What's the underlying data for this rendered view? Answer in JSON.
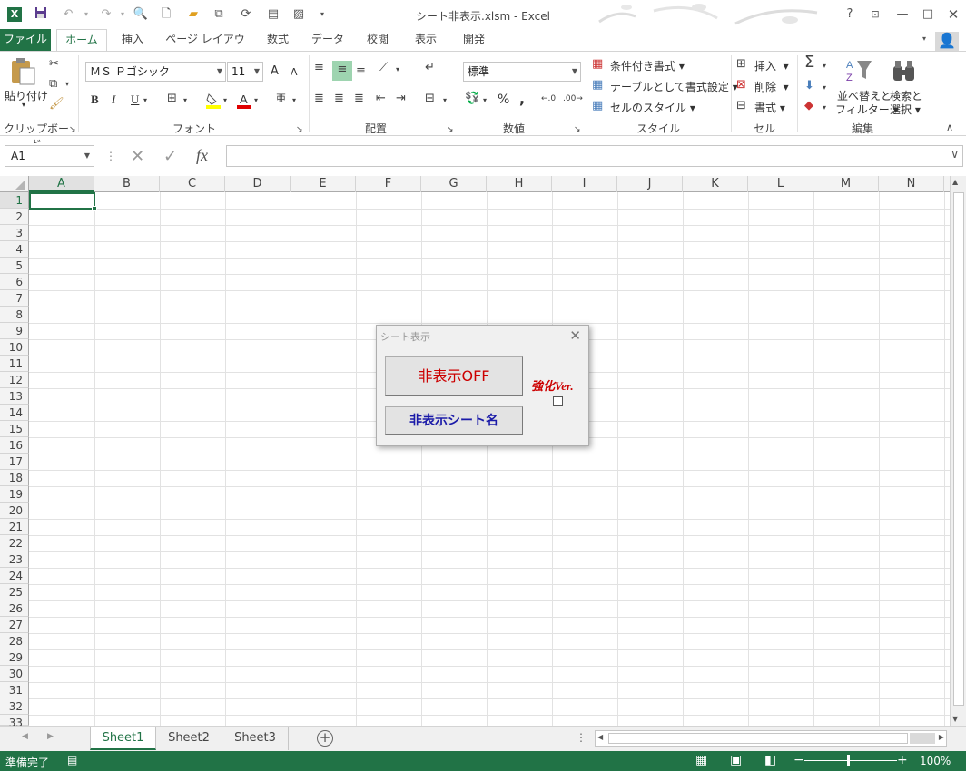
{
  "window": {
    "title": "シート非表示.xlsm - Excel"
  },
  "quick_access": {
    "save": "save-icon",
    "undo": "undo-icon",
    "redo": "redo-icon"
  },
  "tabs": [
    {
      "label": "ファイル"
    },
    {
      "label": "ホーム"
    },
    {
      "label": "挿入"
    },
    {
      "label": "ページ レイアウト"
    },
    {
      "label": "数式"
    },
    {
      "label": "データ"
    },
    {
      "label": "校閲"
    },
    {
      "label": "表示"
    },
    {
      "label": "開発"
    }
  ],
  "ribbon": {
    "clipboard": {
      "paste": "貼り付け",
      "label": "クリップボード"
    },
    "font": {
      "name": "ＭＳ Ｐゴシック",
      "size": "11",
      "bold": "B",
      "italic": "I",
      "underline": "U",
      "grow": "A",
      "shrink": "A",
      "color_a": "A",
      "label": "フォント"
    },
    "alignment": {
      "label": "配置"
    },
    "number": {
      "format": "標準",
      "percent": "%",
      "comma": ",",
      "label": "数値"
    },
    "styles": {
      "conditional": "条件付き書式",
      "table": "テーブルとして書式設定",
      "cell": "セルのスタイル",
      "label": "スタイル"
    },
    "cells": {
      "insert": "挿入",
      "delete": "削除",
      "format": "書式",
      "label": "セル"
    },
    "editing": {
      "sort": "並べ替えと",
      "sort2": "フィルター",
      "find": "検索と",
      "find2": "選択",
      "label": "編集"
    }
  },
  "formula_bar": {
    "name_box": "A1",
    "fx": "fx",
    "value": ""
  },
  "columns": [
    "A",
    "B",
    "C",
    "D",
    "E",
    "F",
    "G",
    "H",
    "I",
    "J",
    "K",
    "L",
    "M",
    "N"
  ],
  "rows": [
    "1",
    "2",
    "3",
    "4",
    "5",
    "6",
    "7",
    "8",
    "9",
    "10",
    "11",
    "12",
    "13",
    "14",
    "15",
    "16",
    "17",
    "18",
    "19",
    "20",
    "21",
    "22",
    "23",
    "24",
    "25",
    "26",
    "27",
    "28",
    "29",
    "30",
    "31",
    "32",
    "33"
  ],
  "selected_cell": "A1",
  "dialog": {
    "title": "シート表示",
    "button_hide_off": "非表示OFF",
    "label_enhanced": "強化Ver.",
    "button_hidden_names": "非表示シート名",
    "checkbox_checked": false
  },
  "sheets": [
    {
      "name": "Sheet1",
      "active": true
    },
    {
      "name": "Sheet2",
      "active": false
    },
    {
      "name": "Sheet3",
      "active": false
    }
  ],
  "status": {
    "ready": "準備完了",
    "zoom": "100%"
  },
  "colors": {
    "excel_green": "#217346",
    "dialog_red": "#cc0000",
    "dialog_blue": "#1a1aa8"
  }
}
